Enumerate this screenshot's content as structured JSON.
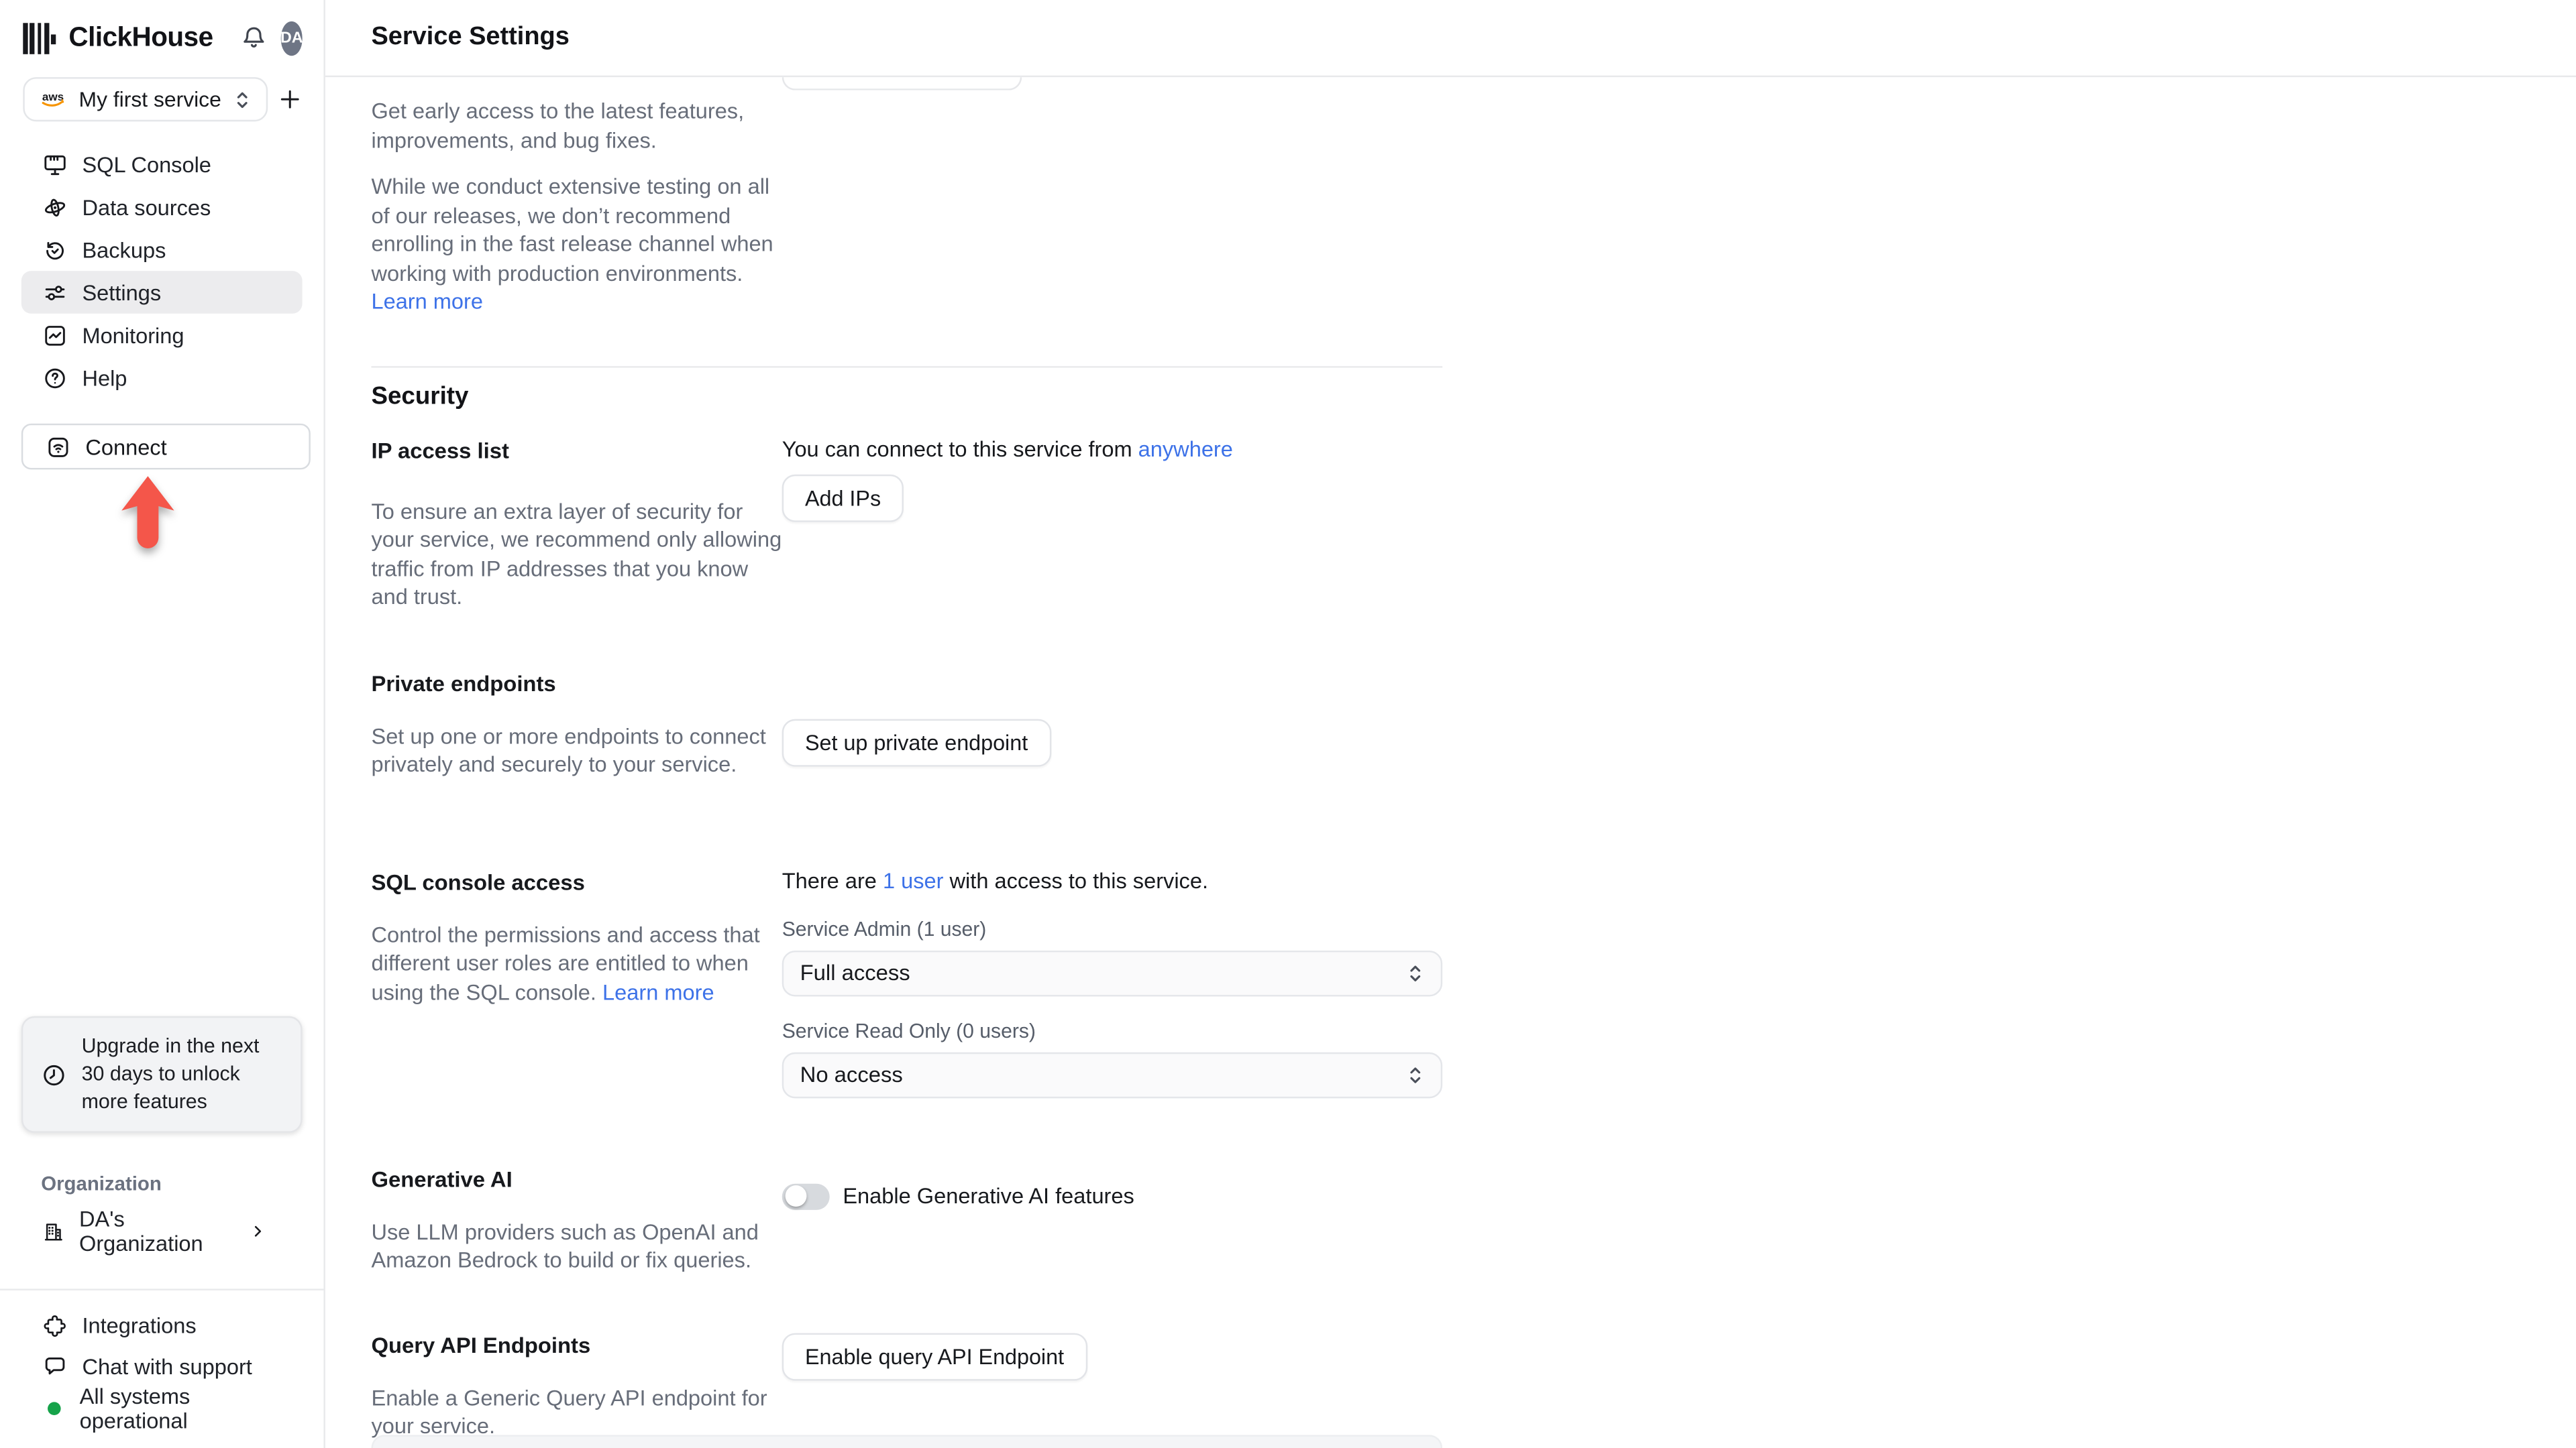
{
  "sidebar": {
    "brand": "ClickHouse",
    "avatar_initials": "DA",
    "service_selector": {
      "label": "My first service",
      "provider": "aws"
    },
    "nav": [
      {
        "label": "SQL Console"
      },
      {
        "label": "Data sources"
      },
      {
        "label": "Backups"
      },
      {
        "label": "Settings"
      },
      {
        "label": "Monitoring"
      },
      {
        "label": "Help"
      }
    ],
    "connect_label": "Connect",
    "upgrade_notice": "Upgrade in the next 30 days to unlock more features",
    "organization_label": "Organization",
    "organization_name": "DA's Organization",
    "footer": [
      {
        "label": "Integrations"
      },
      {
        "label": "Chat with support"
      },
      {
        "label": "All systems operational"
      }
    ]
  },
  "header": {
    "title": "Service Settings"
  },
  "release": {
    "p1": "Get early access to the latest features, improvements, and bug fixes.",
    "p2": "While we conduct extensive testing on all of our releases, we don’t recommend enrolling in the fast release channel when working with production environments. ",
    "learn_more": "Learn more"
  },
  "security": {
    "heading": "Security",
    "ip_access": {
      "title": "IP access list",
      "status_prefix": "You can connect to this service from ",
      "status_link": "anywhere",
      "button": "Add IPs",
      "description": "To ensure an extra layer of security for your service, we recommend only allowing traffic from IP addresses that you know and trust."
    },
    "private_endpoints": {
      "title": "Private endpoints",
      "description": "Set up one or more endpoints to connect privately and securely to your service.",
      "button": "Set up private endpoint"
    },
    "sql_console": {
      "title": "SQL console access",
      "summary_prefix": "There are ",
      "summary_link": "1 user",
      "summary_suffix": " with access to this service.",
      "description": "Control the permissions and access that different user roles are entitled to when using the SQL console. ",
      "learn_more": "Learn more",
      "admin_label": "Service Admin (1 user)",
      "admin_value": "Full access",
      "readonly_label": "Service Read Only (0 users)",
      "readonly_value": "No access"
    },
    "generative_ai": {
      "title": "Generative AI",
      "toggle_label": "Enable Generative AI features",
      "toggle_state": "off",
      "description": "Use LLM providers such as OpenAI and Amazon Bedrock to build or fix queries."
    },
    "query_api": {
      "title": "Query API Endpoints",
      "button": "Enable query API Endpoint",
      "description": "Enable a Generic Query API endpoint for your service."
    }
  },
  "colors": {
    "link_blue": "#3d72e8",
    "arrow_red": "#f4564a",
    "status_green": "#16a34a",
    "aws_orange": "#f79400"
  }
}
